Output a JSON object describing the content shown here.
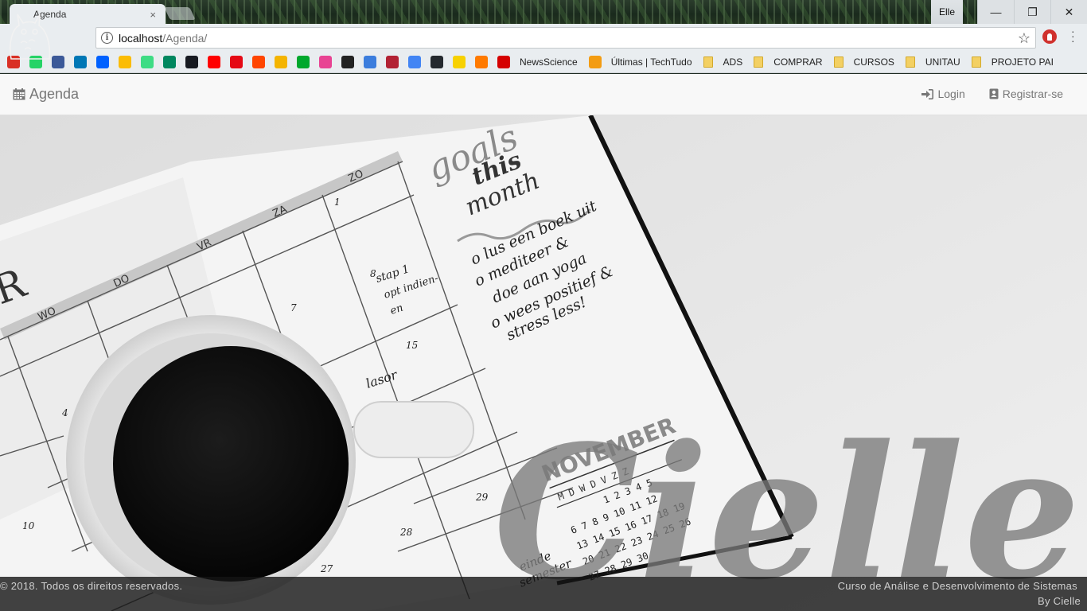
{
  "browser": {
    "tab_title": "Agenda",
    "tab_close": "×",
    "profile_name": "Elle",
    "window_buttons": [
      "—",
      "❐",
      "✕"
    ],
    "url_host": "localhost",
    "url_path": "/Agenda/"
  },
  "bookmarks": {
    "icons": [
      {
        "name": "gmail-icon",
        "color": "#d93025"
      },
      {
        "name": "whatsapp-icon",
        "color": "#25d366"
      },
      {
        "name": "facebook-icon",
        "color": "#3b5998"
      },
      {
        "name": "linkedin-icon",
        "color": "#0077b5"
      },
      {
        "name": "dropbox-icon",
        "color": "#0061ff"
      },
      {
        "name": "google-drive-icon",
        "color": "#fbbc04"
      },
      {
        "name": "android-icon",
        "color": "#3ddc84"
      },
      {
        "name": "google-play-icon",
        "color": "#01875f"
      },
      {
        "name": "steam-icon",
        "color": "#171a21"
      },
      {
        "name": "youtube-icon",
        "color": "#ff0000"
      },
      {
        "name": "netflix-icon",
        "color": "#e50914"
      },
      {
        "name": "reddit-icon",
        "color": "#ff4500"
      },
      {
        "name": "keep-icon",
        "color": "#f4b400"
      },
      {
        "name": "evernote-icon",
        "color": "#00a82d"
      },
      {
        "name": "mosaic-icon",
        "color": "#e84393"
      },
      {
        "name": "speedometer-icon",
        "color": "#222222"
      },
      {
        "name": "calendar-24-icon",
        "color": "#3b7ddd"
      },
      {
        "name": "flag-icon",
        "color": "#b22234"
      },
      {
        "name": "google-sites-icon",
        "color": "#4285f4"
      },
      {
        "name": "github-icon",
        "color": "#24292e"
      },
      {
        "name": "smiley-icon",
        "color": "#f7d100"
      },
      {
        "name": "sun-gear-icon",
        "color": "#ff7a00"
      },
      {
        "name": "s-logo-icon",
        "color": "#d50000"
      }
    ],
    "text_items": [
      {
        "label": "NewsScience",
        "kind": "none"
      },
      {
        "label": "Últimas | TechTudo",
        "kind": "logo"
      },
      {
        "label": "ADS",
        "kind": "folder"
      },
      {
        "label": "COMPRAR",
        "kind": "folder"
      },
      {
        "label": "CURSOS",
        "kind": "folder"
      },
      {
        "label": "UNITAU",
        "kind": "folder"
      },
      {
        "label": "PROJETO PAI",
        "kind": "folder"
      }
    ]
  },
  "navbar": {
    "brand": "Agenda",
    "login": "Login",
    "register": "Registrar-se"
  },
  "hero": {
    "journal_text": {
      "goals": "goals",
      "this": "this",
      "month": "month",
      "notes": [
        "o lus een boek uit",
        "o mediteer &",
        "doe aan yoga",
        "o wees positief &",
        "stress less!"
      ],
      "week_headers": [
        "WO",
        "DO",
        "VR",
        "ZA",
        "ZO"
      ],
      "day_numbers": [
        "1",
        "8",
        "7",
        "15",
        "4",
        "10",
        "29",
        "28",
        "27"
      ],
      "cell_notes": [
        "stap 1",
        "opt indien-",
        "en",
        "lasor",
        "einde",
        "semester"
      ],
      "calendar_title": "NOVEMBER",
      "calendar_days": "M D W D V Z Z",
      "calendar_rows": [
        "1 2 3 4 5",
        "6 7 8 9 10 11 12",
        "13 14 15 16 17 18 19",
        "20 21 22 23 24 25 26",
        "27 28 29 30"
      ]
    },
    "watermark": "Cielle"
  },
  "footer": {
    "copyright": "© 2018. Todos os direitos reservados.",
    "course": "Curso de Análise e Desenvolvimento de Sistemas",
    "by": "By Cielle"
  }
}
